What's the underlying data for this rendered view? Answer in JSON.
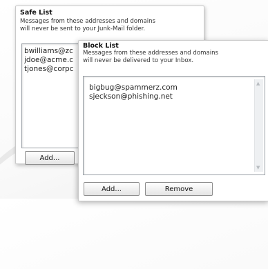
{
  "safe_list": {
    "title": "Safe List",
    "description_line1": "Messages from these addresses and domains",
    "description_line2": "will never be sent to your Junk-Mail folder.",
    "entries": [
      "bwilliams@zc",
      "jdoe@acme.c",
      "tjones@corpc"
    ],
    "add_label": "Add..."
  },
  "block_list": {
    "title": "Block List",
    "description_line1": "Messages from these addresses and domains",
    "description_line2": "will never be delivered to your Inbox.",
    "entries": [
      "bigbug@spammerz.com",
      "sjeckson@phishing.net"
    ],
    "add_label": "Add...",
    "remove_label": "Remove"
  },
  "icons": {
    "scroll_up": "scroll-up-arrow-icon",
    "scroll_down": "scroll-down-arrow-icon"
  }
}
